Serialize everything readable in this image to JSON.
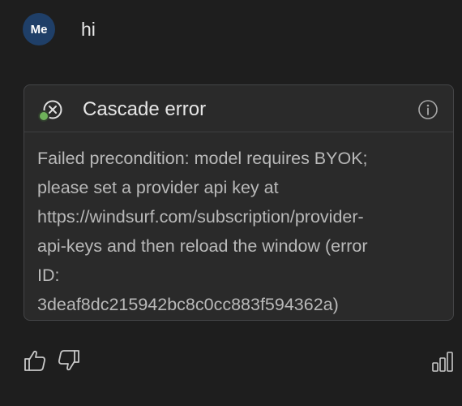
{
  "message": {
    "avatar_text": "Me",
    "text": "hi"
  },
  "error_card": {
    "title": "Cascade error",
    "lines": [
      "Failed precondition: model requires BYOK;",
      "please set a provider api key at",
      "https://windsurf.com/subscription/provider-",
      "api-keys and then reload the window (error",
      "ID:",
      "3deaf8dc215942bc8c0cc883f594362a)"
    ],
    "icons": {
      "error": "close-circle-icon",
      "info": "info-icon"
    }
  },
  "feedback": {
    "icons": [
      "thumbs-up-icon",
      "thumbs-down-icon",
      "bar-chart-icon"
    ]
  },
  "colors": {
    "background": "#1e1e1e",
    "avatar": "#1f3f68",
    "card": "#2a2a2a",
    "status_dot": "#6eb15a"
  }
}
